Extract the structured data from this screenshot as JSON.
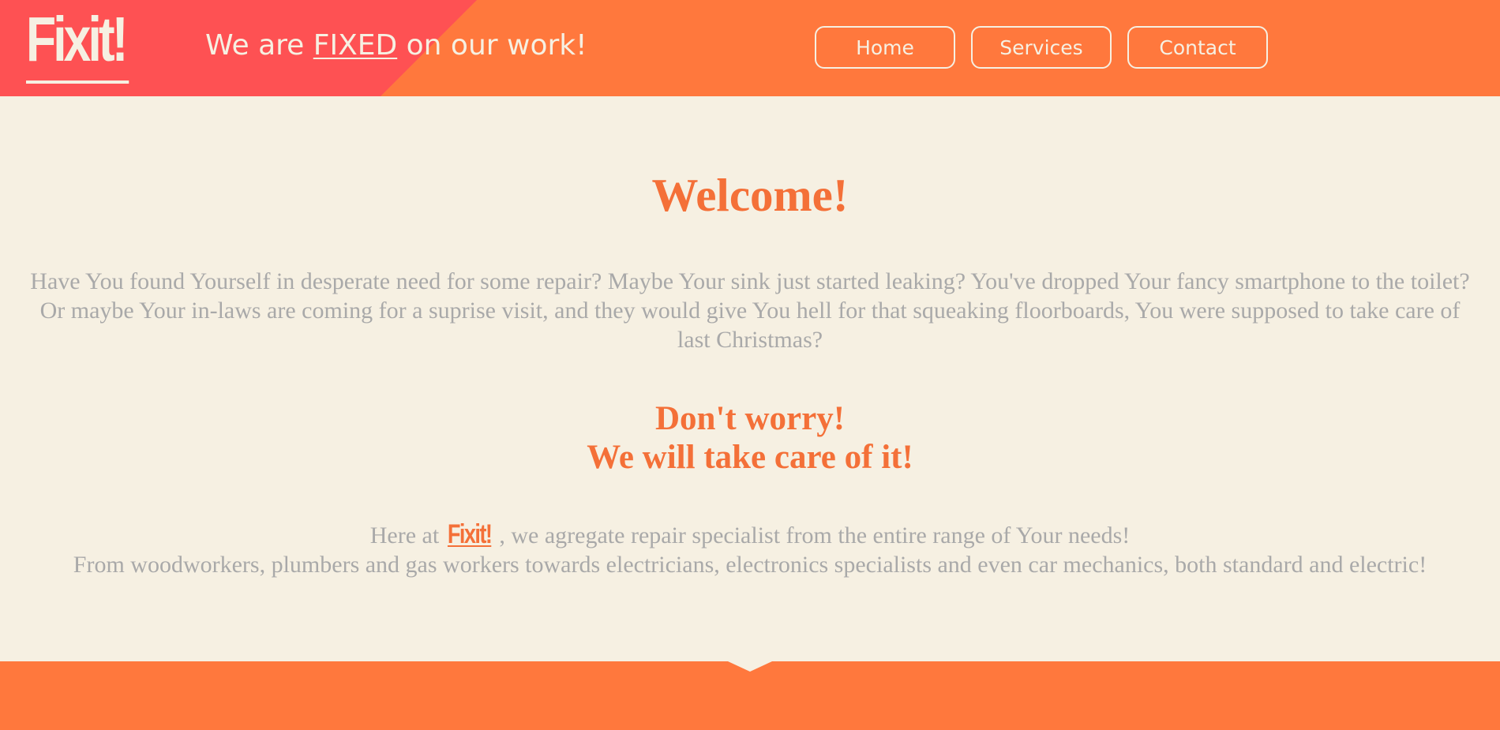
{
  "header": {
    "logo": "Fixit!",
    "tagline_before": "We are ",
    "tagline_fixed": "FIXED",
    "tagline_after": " on our work!",
    "nav": [
      "Home",
      "Services",
      "Contact"
    ]
  },
  "main": {
    "welcome": "Welcome!",
    "intro": "Have You found Yourself in desperate need for some repair? Maybe Your sink just started leaking? You've dropped Your fancy smartphone to the toilet? Or maybe Your in-laws are coming for a suprise visit, and they would give You hell for that squeaking floorboards, You were supposed to take care of last Christmas?",
    "worry_line1": "Don't worry!",
    "worry_line2": "We will take care of it!",
    "about_before": "Here at ",
    "about_logo": "Fixit!",
    "about_after": " , we agregate repair specialist from the entire range of Your needs!",
    "about_line2": "From woodworkers, plumbers and gas workers towards electricians, electronics specialists and even car mechanics, both standard and electric!"
  },
  "colors": {
    "header_bg": "#ff783d",
    "header_accent": "#fe5153",
    "page_bg": "#f6f0e2",
    "heading": "#f47038",
    "body_text": "#a9a9a9"
  }
}
